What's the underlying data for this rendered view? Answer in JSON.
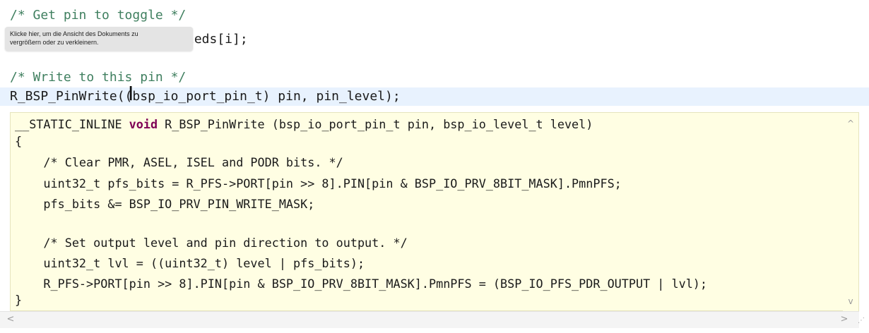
{
  "editor": {
    "comment_get_pin": "/* Get pin to toggle */",
    "code_leds": "leds[i];",
    "comment_write_pin": "/* Write to this pin */",
    "current_line": "R_BSP_PinWrite((bsp_io_port_pin_t) pin, pin_level);"
  },
  "tooltip": {
    "line1": "Klicke hier, um die Ansicht des Dokuments zu",
    "line2": "vergrößern oder zu verkleinern."
  },
  "hover": {
    "sig_prefix": "__STATIC_INLINE ",
    "sig_keyword": "void",
    "sig_rest": " R_BSP_PinWrite (bsp_io_port_pin_t pin, bsp_io_level_t level)",
    "open_brace": "{",
    "comment_clear": "    /* Clear PMR, ASEL, ISEL and PODR bits. */",
    "line_pfs": "    uint32_t pfs_bits = R_PFS->PORT[pin >> 8].PIN[pin & BSP_IO_PRV_8BIT_MASK].PmnPFS;",
    "line_mask": "    pfs_bits &= BSP_IO_PRV_PIN_WRITE_MASK;",
    "comment_set": "    /* Set output level and pin direction to output. */",
    "line_lvl": "    uint32_t lvl = ((uint32_t) level | pfs_bits);",
    "line_write": "    R_PFS->PORT[pin >> 8].PIN[pin & BSP_IO_PRV_8BIT_MASK].PmnPFS = (BSP_IO_PFS_PDR_OUTPUT | lvl);",
    "close_brace": "}"
  },
  "icons": {
    "text_cursor": "I",
    "scroll_up": "^",
    "scroll_down": "v",
    "scroll_left": "<",
    "scroll_right": ">",
    "resize_grip": "⋰"
  },
  "colors": {
    "comment": "#3f7f5f",
    "keyword": "#7f0055",
    "hover_background": "#fffee3",
    "current_line_background": "#e8f2fe"
  }
}
